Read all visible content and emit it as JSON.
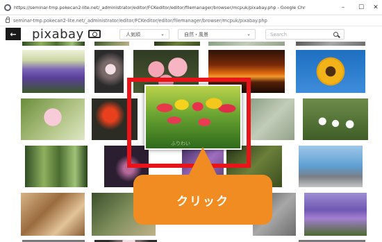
{
  "browser": {
    "title": "https://seminar-tmp.pokecan2-lite.net/_administrator/editor/FCKeditor/editor/filemanager/browser/mcpuk/pixabay.php - Google Chrome",
    "url": "seminar-tmp.pokecan2-lite.net/_administrator/editor/FCKeditor/editor/filemanager/browser/mcpuk/pixabay.php",
    "minimize": "–",
    "maximize": "☐",
    "close": "✕"
  },
  "header": {
    "back_glyph": "←",
    "logo": "pixabay",
    "sort_select": "人気順",
    "category_select": "自然・風景",
    "search_placeholder": "Search"
  },
  "overlay": {
    "callout_text": "クリック",
    "highlight_color": "#e8141a",
    "callout_color": "#f08c22"
  },
  "watermark": "ふりわい"
}
